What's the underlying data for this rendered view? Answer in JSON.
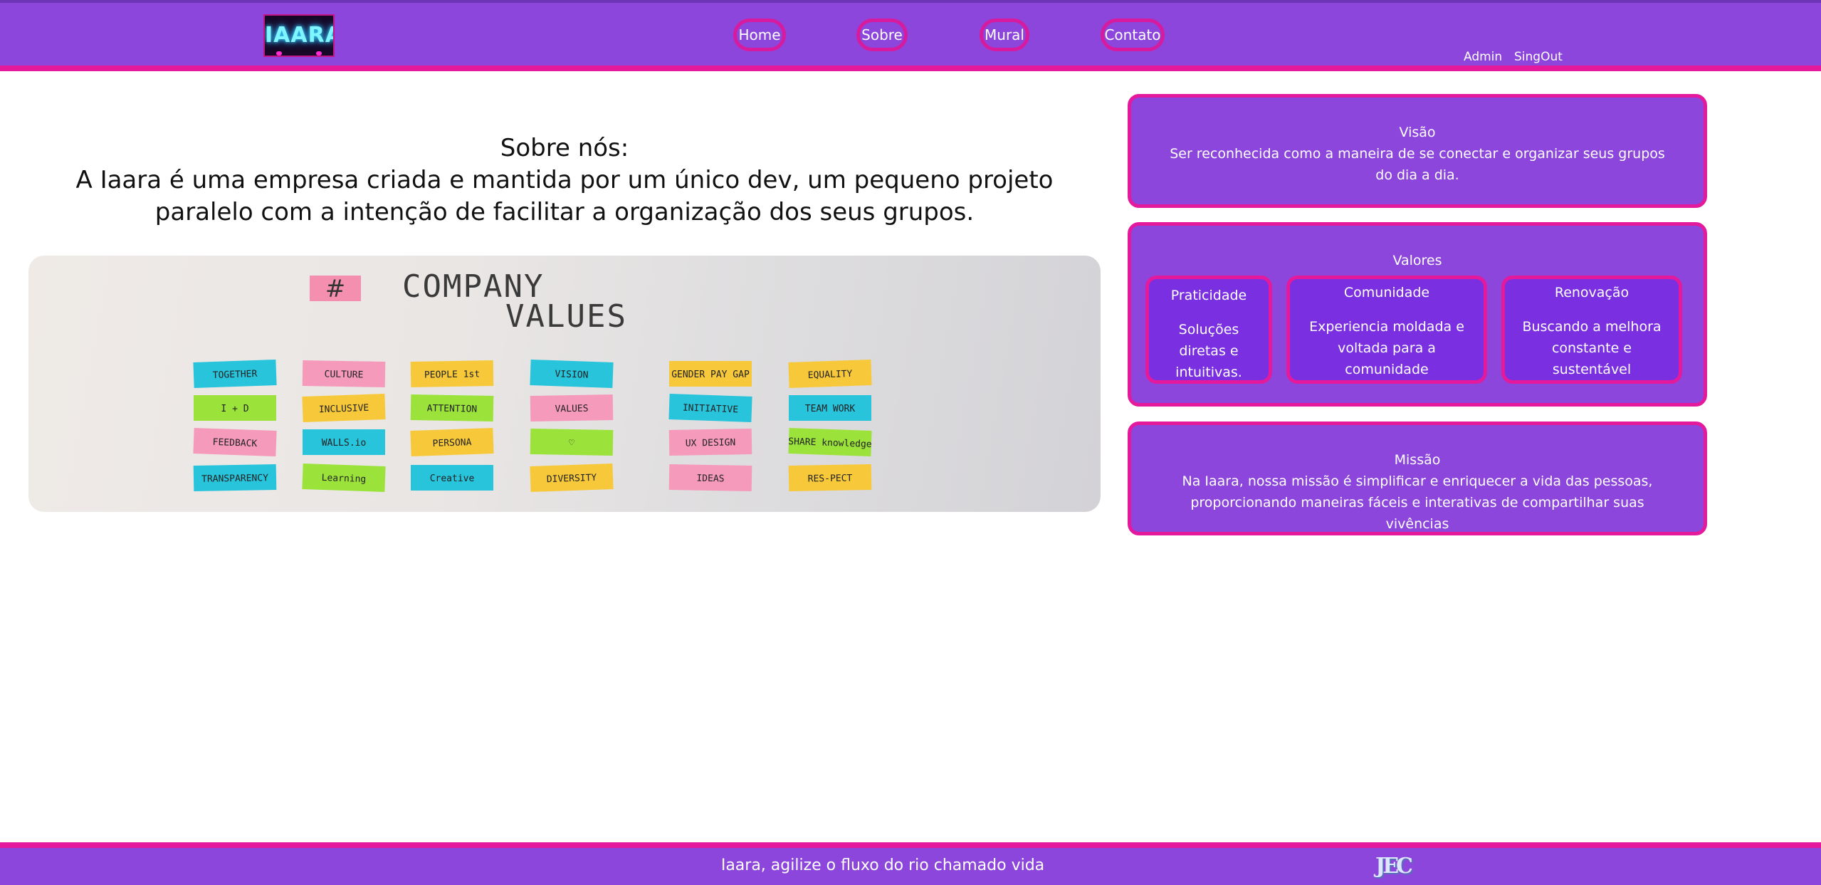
{
  "header": {
    "logo_text": "IAARA",
    "nav": [
      "Home",
      "Sobre",
      "Mural",
      "Contato"
    ],
    "links": {
      "admin": "Admin",
      "signout": "SingOut"
    }
  },
  "about": {
    "line1": "Sobre nós:",
    "line2": "A Iaara é uma empresa criada e mantida por um único dev, um pequeno projeto paralelo com a intenção de facilitar a organização dos seus grupos."
  },
  "image": {
    "title_hash": "#",
    "title_line1": "COMPANY",
    "title_line2": "VALUES",
    "notes": [
      "TOGETHER",
      "CULTURE",
      "PEOPLE 1st",
      "VISION",
      "GENDER PAY GAP",
      "EQUALITY",
      "I + D",
      "INCLUSIVE",
      "ATTENTION",
      "VALUES",
      "INITIATIVE",
      "TEAM WORK",
      "FEEDBACK",
      "WALLS.io",
      "PERSONA",
      "♡",
      "UX DESIGN",
      "SHARE knowledge",
      "TRANSPARENCY",
      "Learning",
      "Creative",
      "DIVERSITY",
      "IDEAS",
      "RES-PECT"
    ]
  },
  "visao": {
    "title": "Visão",
    "text": "Ser reconhecida como a maneira de se conectar e organizar seus grupos do dia a dia."
  },
  "valores": {
    "title": "Valores",
    "cards": [
      {
        "title": "Praticidade",
        "text": "Soluções diretas e intuitivas."
      },
      {
        "title": "Comunidade",
        "text": "Experiencia moldada e voltada para a comunidade"
      },
      {
        "title": "Renovação",
        "text": "Buscando a melhora constante e sustentável"
      }
    ]
  },
  "missao": {
    "title": "Missão",
    "text": "Na Iaara, nossa missão é simplificar e enriquecer a vida das pessoas, proporcionando maneiras fáceis e interativas de compartilhar suas vivências"
  },
  "footer": {
    "text": "Iaara, agilize o fluxo do rio chamado vida",
    "logo_text": "JEC"
  },
  "colors": {
    "purple": "#8d46dc",
    "magenta": "#e5199c",
    "card_purple": "#7a2fe0"
  }
}
